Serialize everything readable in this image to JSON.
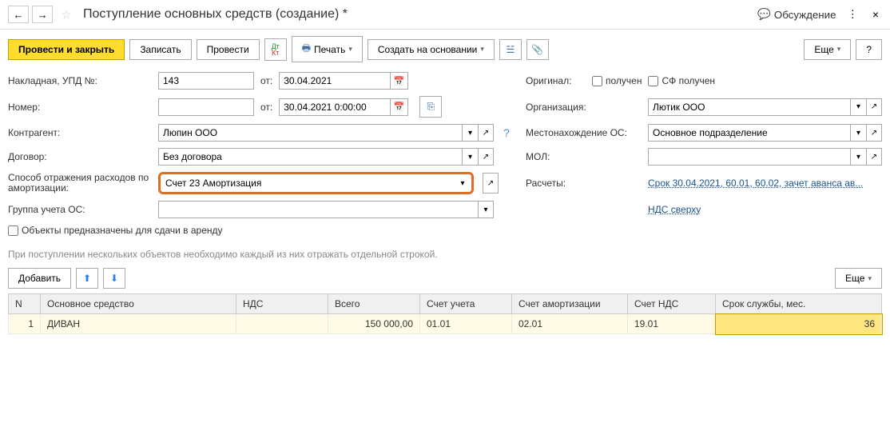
{
  "header": {
    "title": "Поступление основных средств (создание) *",
    "discuss": "Обсуждение"
  },
  "toolbar": {
    "post_close": "Провести и закрыть",
    "write": "Записать",
    "post": "Провести",
    "print": "Печать",
    "create_based": "Создать на основании",
    "more": "Еще",
    "help": "?"
  },
  "form": {
    "invoice_label": "Накладная, УПД №:",
    "invoice_num": "143",
    "from_label": "от:",
    "invoice_date": "30.04.2021",
    "original_label": "Оригинал:",
    "received": "получен",
    "sf_received": "СФ получен",
    "number_label": "Номер:",
    "number_date": "30.04.2021 0:00:00",
    "org_label": "Организация:",
    "org_value": "Лютик ООО",
    "counterparty_label": "Контрагент:",
    "counterparty_value": "Люпин ООО",
    "location_label": "Местонахождение ОС:",
    "location_value": "Основное подразделение",
    "contract_label": "Договор:",
    "contract_value": "Без договора",
    "mol_label": "МОЛ:",
    "amort_label": "Способ отражения расходов по амортизации:",
    "amort_value": "Счет 23 Амортизация",
    "calc_label": "Расчеты:",
    "calc_link": "Срок 30.04.2021, 60.01, 60.02, зачет аванса ав...",
    "group_label": "Группа учета ОС:",
    "vat_link": "НДС сверху",
    "rent_checkbox": "Объекты предназначены для сдачи в аренду",
    "info_text": "При поступлении нескольких объектов необходимо каждый из них отражать отдельной строкой."
  },
  "table_toolbar": {
    "add": "Добавить",
    "more": "Еще"
  },
  "table": {
    "headers": {
      "n": "N",
      "asset": "Основное средство",
      "vat": "НДС",
      "total": "Всего",
      "account": "Счет учета",
      "amort_account": "Счет амортизации",
      "vat_account": "Счет НДС",
      "life": "Срок службы, мес."
    },
    "rows": [
      {
        "n": "1",
        "asset": "ДИВАН",
        "vat": "",
        "total": "150 000,00",
        "account": "01.01",
        "amort_account": "02.01",
        "vat_account": "19.01",
        "life": "36"
      }
    ]
  }
}
